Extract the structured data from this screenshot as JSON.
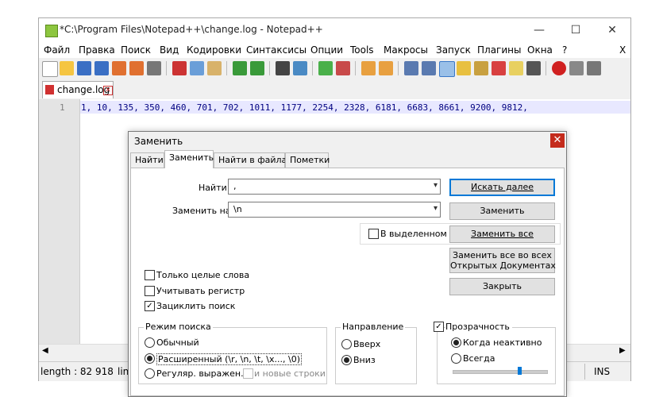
{
  "window": {
    "title": "*C:\\Program Files\\Notepad++\\change.log - Notepad++",
    "controls": {
      "minimize": "—",
      "maximize": "☐",
      "close": "✕"
    }
  },
  "menu": {
    "items": [
      "Файл",
      "Правка",
      "Поиск",
      "Вид",
      "Кодировки",
      "Синтаксисы",
      "Опции",
      "Tools",
      "Макросы",
      "Запуск",
      "Плагины",
      "Окна",
      "?"
    ],
    "close_doc": "X"
  },
  "tab": {
    "label": "change.log"
  },
  "editor": {
    "line_number": "1",
    "line_text": "1, 10, 135, 350, 460, 701, 702, 1011, 1177, 2254, 2328, 6181, 6683, 8661, 9200, 9812,"
  },
  "statusbar": {
    "length": "length : 82 918",
    "line": "lin",
    "ins": "INS"
  },
  "dialog": {
    "title": "Заменить",
    "close": "✕",
    "tabs": [
      "Найти",
      "Заменить",
      "Найти в файлах",
      "Пометки"
    ],
    "find_label": "Найти:",
    "find_value": ",",
    "replace_label": "Заменить на:",
    "replace_value": "\\n",
    "in_selection": "В выделенном",
    "buttons": {
      "find_next": "Искать далее",
      "replace": "Заменить",
      "replace_all": "Заменить все",
      "replace_all_open_1": "Заменить все во всех",
      "replace_all_open_2": "Открытых Документах",
      "close": "Закрыть"
    },
    "options": {
      "whole_words": "Только целые слова",
      "match_case": "Учитывать регистр",
      "wrap": "Зациклить поиск"
    },
    "search_mode": {
      "title": "Режим поиска",
      "normal": "Обычный",
      "extended": "Расширенный (\\r, \\n, \\t, \\x..., \\0)",
      "regex": "Регуляр. выражен.",
      "newlines": "и новые строки"
    },
    "direction": {
      "title": "Направление",
      "up": "Вверх",
      "down": "Вниз"
    },
    "transparency": {
      "title": "Прозрачность",
      "inactive": "Когда неактивно",
      "always": "Всегда",
      "level": 0.7
    }
  },
  "colors": {
    "accent": "#0078d7",
    "line_highlight": "#e8e8ff",
    "close_red": "#c42b1c"
  }
}
